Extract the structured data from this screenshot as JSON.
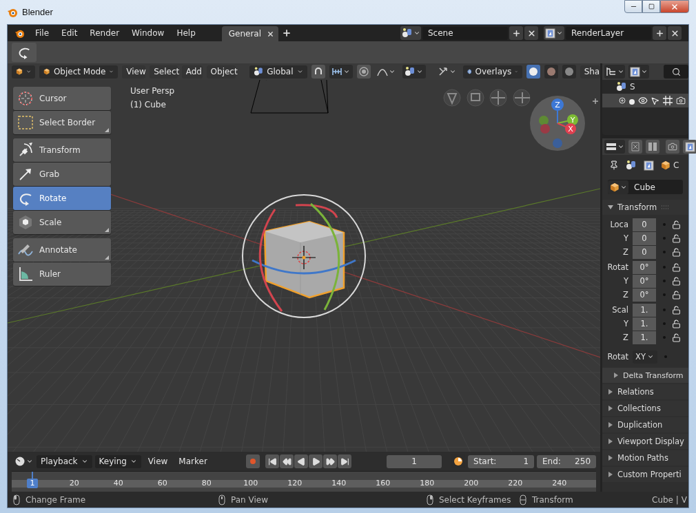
{
  "window": {
    "title": "Blender"
  },
  "menu_bar": {
    "items": [
      "File",
      "Edit",
      "Render",
      "Window",
      "Help"
    ]
  },
  "workspace_tabs": [
    {
      "label": "General",
      "selected": true
    }
  ],
  "scene_selector": {
    "value": "Scene"
  },
  "layer_selector": {
    "value": "RenderLayer"
  },
  "viewport_header": {
    "mode": "Object Mode",
    "menus": [
      "View",
      "Select",
      "Add",
      "Object"
    ],
    "orientation": "Global",
    "overlays": "Overlays",
    "shading": "Sha"
  },
  "viewport": {
    "view_name": "User Persp",
    "object_label": "(1) Cube",
    "axes": [
      "Z",
      "Y",
      "X"
    ]
  },
  "tool_groups": [
    [
      {
        "label": "Cursor",
        "kind": "cursor",
        "selected": false,
        "more": false
      },
      {
        "label": "Select Border",
        "kind": "select",
        "selected": false,
        "more": true
      }
    ],
    [
      {
        "label": "Transform",
        "kind": "transform",
        "selected": false,
        "more": false
      },
      {
        "label": "Grab",
        "kind": "grab",
        "selected": false,
        "more": false
      },
      {
        "label": "Rotate",
        "kind": "rotate",
        "selected": true,
        "more": false
      },
      {
        "label": "Scale",
        "kind": "scale",
        "selected": false,
        "more": true
      }
    ],
    [
      {
        "label": "Annotate",
        "kind": "annotate",
        "selected": false,
        "more": true
      },
      {
        "label": "Ruler",
        "kind": "ruler",
        "selected": false,
        "more": false
      }
    ]
  ],
  "outliner": {
    "scene_label": "S"
  },
  "properties": {
    "context_label": "C",
    "object_name": "Cube",
    "transform": {
      "title": "Transform",
      "expanded": true,
      "rows": [
        {
          "label": "Loca",
          "value": "0"
        },
        {
          "label": "Y",
          "value": "0"
        },
        {
          "label": "Z",
          "value": "0"
        },
        {
          "label": "Rotat",
          "value": "0°"
        },
        {
          "label": "Y",
          "value": "0°"
        },
        {
          "label": "Z",
          "value": "0°"
        },
        {
          "label": "Scal",
          "value": "1."
        },
        {
          "label": "Y",
          "value": "1."
        },
        {
          "label": "Z",
          "value": "1."
        }
      ]
    },
    "rotation_mode": {
      "label": "Rotat",
      "value": "XY"
    },
    "panels": [
      {
        "title": "Delta Transform",
        "kind": "subpanel",
        "expanded": false
      },
      {
        "title": "Relations",
        "kind": "panel",
        "expanded": false
      },
      {
        "title": "Collections",
        "kind": "panel",
        "expanded": false
      },
      {
        "title": "Duplication",
        "kind": "panel",
        "expanded": false
      },
      {
        "title": "Viewport Display",
        "kind": "panel",
        "expanded": false
      },
      {
        "title": "Motion Paths",
        "kind": "panel",
        "expanded": false
      },
      {
        "title": "Custom Properti",
        "kind": "panel",
        "expanded": false
      }
    ]
  },
  "timeline": {
    "menus": [
      {
        "label": "Playback",
        "kind": "dropdown"
      },
      {
        "label": "Keying",
        "kind": "dropdown"
      },
      {
        "label": "View",
        "kind": "plain"
      },
      {
        "label": "Marker",
        "kind": "plain"
      }
    ],
    "current_frame": "1",
    "start_label": "Start:",
    "start": "1",
    "end_label": "End:",
    "end": "250",
    "marker": "1",
    "ruler": [
      "20",
      "40",
      "60",
      "80",
      "100",
      "120",
      "140",
      "160",
      "180",
      "200",
      "220",
      "240"
    ]
  },
  "status_bar": {
    "hints": [
      {
        "label": "Change Frame",
        "kind": "left"
      },
      {
        "label": "Pan View",
        "kind": "middle"
      },
      {
        "label": "Select Keyframes",
        "kind": "right"
      },
      {
        "label": "Transform",
        "kind": "drag"
      }
    ],
    "info": "Cube | V"
  }
}
